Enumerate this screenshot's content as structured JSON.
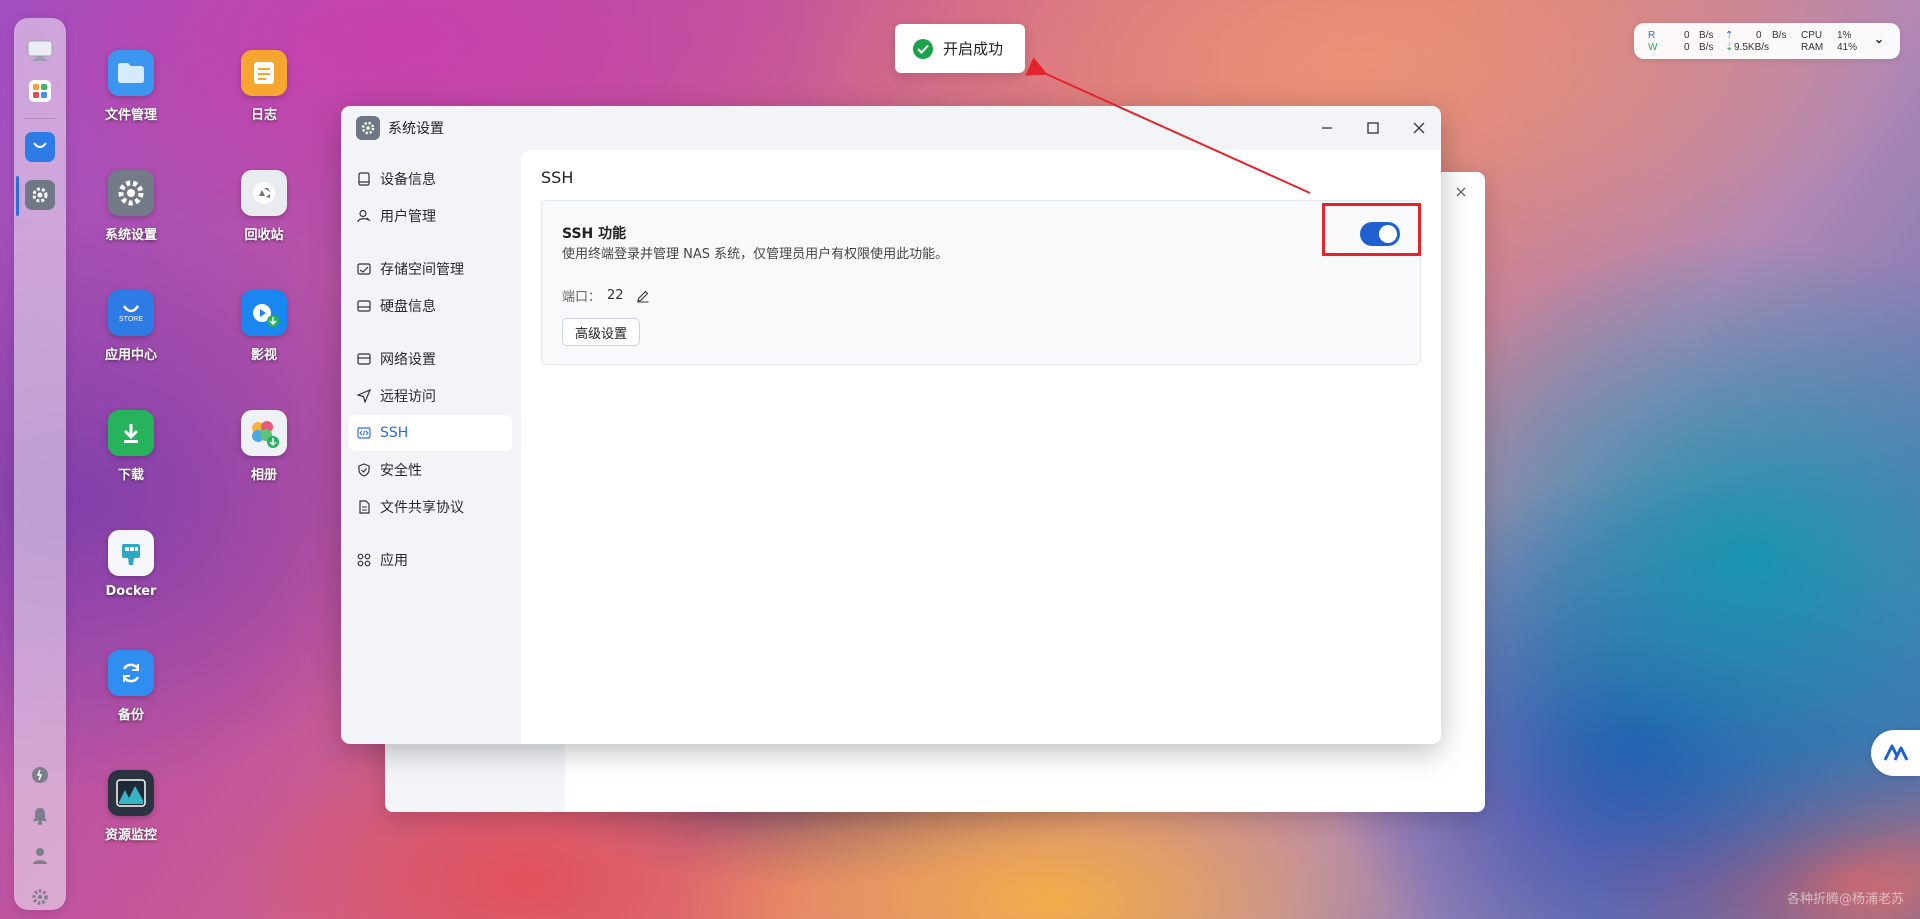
{
  "desktop": {
    "icons": [
      {
        "label": "文件管理"
      },
      {
        "label": "日志"
      },
      {
        "label": "系统设置"
      },
      {
        "label": "回收站"
      },
      {
        "label": "应用中心"
      },
      {
        "label": "影视"
      },
      {
        "label": "下载"
      },
      {
        "label": "相册"
      },
      {
        "label": "Docker"
      },
      {
        "label": "备份"
      },
      {
        "label": "资源监控"
      }
    ],
    "store_text": "STORE"
  },
  "toast": {
    "text": "开启成功",
    "color": "#1aa34a"
  },
  "stats": {
    "r_label": "R",
    "w_label": "W",
    "r_upload": "0",
    "r_upload_unit": "B/s",
    "r_download": "0",
    "r_download_unit": "B/s",
    "w_upload": "0",
    "w_upload_unit": "B/s",
    "w_download": "9.5KB/s",
    "cpu_label": "CPU",
    "cpu_value": "1%",
    "ram_label": "RAM",
    "ram_value": "41%"
  },
  "window": {
    "title": "系统设置",
    "nav": [
      {
        "label": "设备信息",
        "icon": "device-icon"
      },
      {
        "label": "用户管理",
        "icon": "user-icon"
      },
      {
        "label": "存储空间管理",
        "icon": "storage-icon"
      },
      {
        "label": "硬盘信息",
        "icon": "disk-icon"
      },
      {
        "label": "网络设置",
        "icon": "network-icon"
      },
      {
        "label": "远程访问",
        "icon": "send-icon"
      },
      {
        "label": "SSH",
        "icon": "code-icon",
        "active": true
      },
      {
        "label": "安全性",
        "icon": "shield-icon"
      },
      {
        "label": "文件共享协议",
        "icon": "file-icon"
      },
      {
        "label": "应用",
        "icon": "apps-icon"
      }
    ],
    "section_title": "SSH",
    "card": {
      "title": "SSH 功能",
      "description": "使用终端登录并管理 NAS 系统，仅管理员用户有权限使用此功能。",
      "port_label": "端口：",
      "port_value": "22",
      "advanced_button": "高级设置",
      "enabled": true
    }
  },
  "accent_color": "#1f5fd0",
  "highlight_color": "#e3252b",
  "watermark": "各种折腾@杨浦老苏"
}
